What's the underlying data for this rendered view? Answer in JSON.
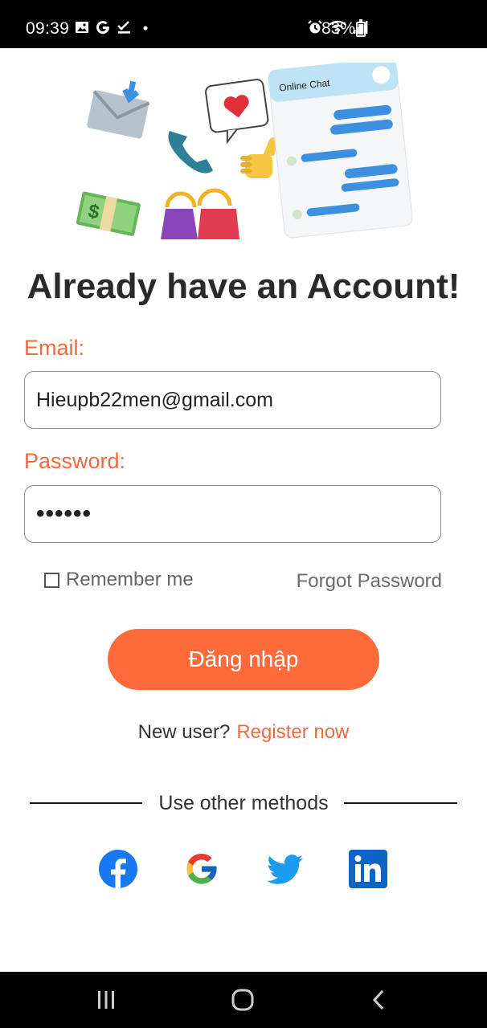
{
  "status_bar": {
    "time": "09:39",
    "notification_icons": [
      "image-icon",
      "google-icon",
      "check-icon",
      "dot-icon"
    ],
    "system_icons": [
      "alarm-icon",
      "wifi-icon",
      "signal-icon"
    ],
    "battery": "83%"
  },
  "hero": {
    "chat_title": "Online Chat"
  },
  "page": {
    "title": "Already have an Account!"
  },
  "form": {
    "email_label": "Email:",
    "email_value": "Hieupb22men@gmail.com",
    "password_label": "Password:",
    "password_masked": "••••••",
    "remember_label": "Remember me",
    "forgot_label": "Forgot Password",
    "login_label": "Đăng nhập"
  },
  "register": {
    "question": "New user?",
    "link": "Register now"
  },
  "other_methods": {
    "label": "Use other methods",
    "providers": [
      "facebook-icon",
      "google-icon",
      "twitter-icon",
      "linkedin-icon"
    ]
  },
  "colors": {
    "accent": "#ff6a3a",
    "label": "#ef6a3f",
    "facebook": "#1877f2",
    "twitter": "#1d9bf0",
    "linkedin": "#0a66c2"
  }
}
